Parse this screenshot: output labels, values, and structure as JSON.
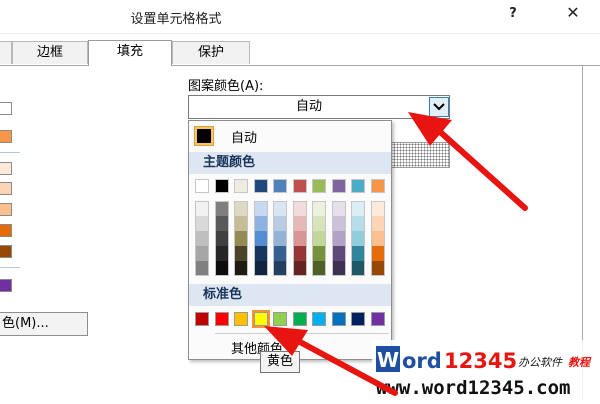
{
  "window": {
    "title": "设置单元格格式",
    "help_label": "?",
    "close_label": "✕"
  },
  "tabs": [
    {
      "label": "边框"
    },
    {
      "label": "填充"
    },
    {
      "label": "保护"
    }
  ],
  "left": {
    "color_button_label": "色(M)..."
  },
  "pattern_color": {
    "label": "图案颜色(A):",
    "value": "自动"
  },
  "popup": {
    "auto_label": "自动",
    "theme_header": "主题颜色",
    "standard_header": "标准色",
    "more_colors_label": "其他颜色..."
  },
  "tooltip": {
    "text": "黄色"
  },
  "watermark": {
    "brand_word": "Word",
    "brand_num": "12345",
    "brand_cn": "办公软件",
    "brand_tag": "教程",
    "url": "www.word12345.com"
  },
  "colors": {
    "theme_top": [
      "#ffffff",
      "#000000",
      "#eeece1",
      "#1f497d",
      "#4f81bd",
      "#c0504d",
      "#9bbb59",
      "#8064a2",
      "#4bacc6",
      "#f79646"
    ],
    "theme_shades": [
      [
        "#f2f2f2",
        "#d9d9d9",
        "#bfbfbf",
        "#a6a6a6",
        "#808080"
      ],
      [
        "#7f7f7f",
        "#595959",
        "#404040",
        "#262626",
        "#0d0d0d"
      ],
      [
        "#ddd9c3",
        "#c4bd97",
        "#948a54",
        "#4a452a",
        "#1e1c11"
      ],
      [
        "#c6d9f0",
        "#8db3e2",
        "#548dd4",
        "#17365d",
        "#0f243e"
      ],
      [
        "#dbe5f1",
        "#b8cce4",
        "#95b3d7",
        "#366092",
        "#244061"
      ],
      [
        "#f2dcdb",
        "#e5b9b7",
        "#d99694",
        "#953734",
        "#632423"
      ],
      [
        "#ebf1dd",
        "#d7e3bc",
        "#c3d69b",
        "#76923c",
        "#4f6128"
      ],
      [
        "#e5e0ec",
        "#ccc1d9",
        "#b2a2c7",
        "#5f497a",
        "#3f3151"
      ],
      [
        "#dbeef3",
        "#b7dde8",
        "#92cddc",
        "#31859b",
        "#205867"
      ],
      [
        "#fdeada",
        "#fbd5b5",
        "#fac08f",
        "#e36c09",
        "#974806"
      ]
    ],
    "standard": [
      "#c00000",
      "#ff0000",
      "#ffc000",
      "#ffff00",
      "#92d050",
      "#00b050",
      "#00b0f0",
      "#0070c0",
      "#002060",
      "#7030a0"
    ],
    "hover_index": 3,
    "arrow": "#e8140f",
    "left_swatches": [
      "#ffffff",
      "#f79646",
      "#fde9d9",
      "#fbd5b5",
      "#fac08f",
      "#e36c09",
      "#974806",
      "#7030a0"
    ]
  }
}
